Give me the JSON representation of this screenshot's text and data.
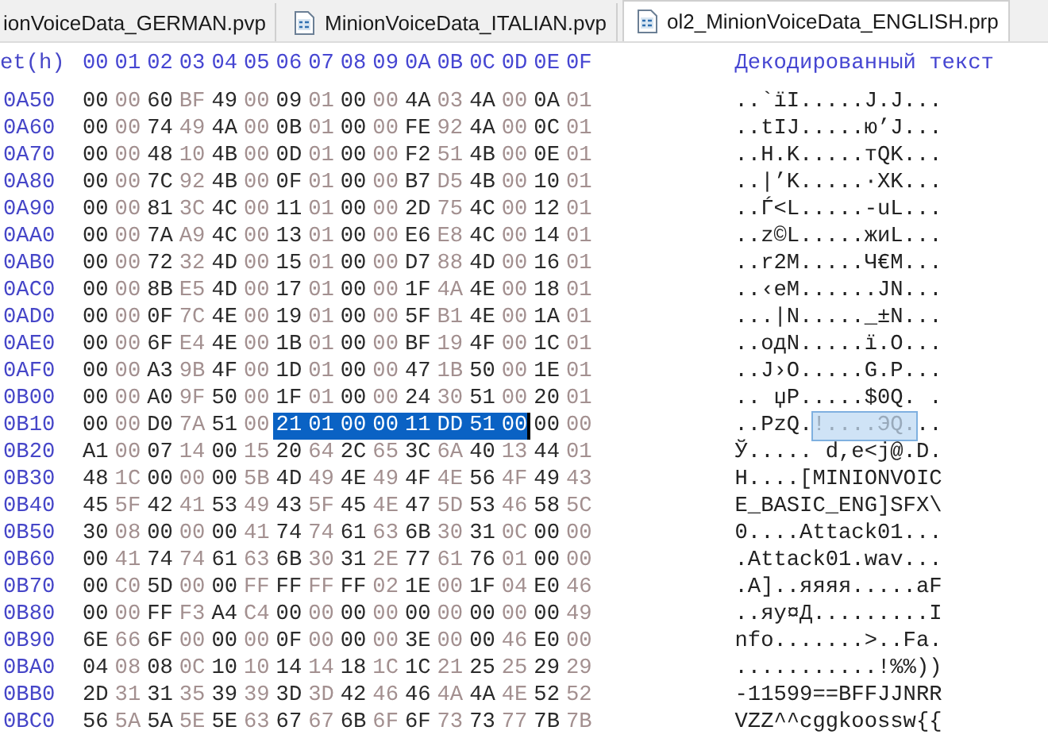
{
  "tabs": [
    {
      "label": "ionVoiceData_GERMAN.pvp",
      "selected": false,
      "icon": false
    },
    {
      "label": "MinionVoiceData_ITALIAN.pvp",
      "selected": false,
      "icon": true
    },
    {
      "label": "ol2_MinionVoiceData_ENGLISH.prp",
      "selected": true,
      "icon": true
    }
  ],
  "header": {
    "offset_label": "et(h)",
    "columns": [
      "00",
      "01",
      "02",
      "03",
      "04",
      "05",
      "06",
      "07",
      "08",
      "09",
      "0A",
      "0B",
      "0C",
      "0D",
      "0E",
      "0F"
    ],
    "text_label": "Декодированный текст"
  },
  "rows": [
    {
      "offset": "0A50",
      "bytes": [
        "00",
        "00",
        "60",
        "BF",
        "49",
        "00",
        "09",
        "01",
        "00",
        "00",
        "4A",
        "03",
        "4A",
        "00",
        "0A",
        "01"
      ],
      "text": "..`їI.....J.J..."
    },
    {
      "offset": "0A60",
      "bytes": [
        "00",
        "00",
        "74",
        "49",
        "4A",
        "00",
        "0B",
        "01",
        "00",
        "00",
        "FE",
        "92",
        "4A",
        "00",
        "0C",
        "01"
      ],
      "text": "..tIJ.....ю’J..."
    },
    {
      "offset": "0A70",
      "bytes": [
        "00",
        "00",
        "48",
        "10",
        "4B",
        "00",
        "0D",
        "01",
        "00",
        "00",
        "F2",
        "51",
        "4B",
        "00",
        "0E",
        "01"
      ],
      "text": "..H.K.....тQK..."
    },
    {
      "offset": "0A80",
      "bytes": [
        "00",
        "00",
        "7C",
        "92",
        "4B",
        "00",
        "0F",
        "01",
        "00",
        "00",
        "B7",
        "D5",
        "4B",
        "00",
        "10",
        "01"
      ],
      "text": "..|’K.....·ХK..."
    },
    {
      "offset": "0A90",
      "bytes": [
        "00",
        "00",
        "81",
        "3C",
        "4C",
        "00",
        "11",
        "01",
        "00",
        "00",
        "2D",
        "75",
        "4C",
        "00",
        "12",
        "01"
      ],
      "text": "..Ѓ<L.....-uL..."
    },
    {
      "offset": "0AA0",
      "bytes": [
        "00",
        "00",
        "7A",
        "A9",
        "4C",
        "00",
        "13",
        "01",
        "00",
        "00",
        "E6",
        "E8",
        "4C",
        "00",
        "14",
        "01"
      ],
      "text": "..z©L.....жиL..."
    },
    {
      "offset": "0AB0",
      "bytes": [
        "00",
        "00",
        "72",
        "32",
        "4D",
        "00",
        "15",
        "01",
        "00",
        "00",
        "D7",
        "88",
        "4D",
        "00",
        "16",
        "01"
      ],
      "text": "..r2M.....Ч€M..."
    },
    {
      "offset": "0AC0",
      "bytes": [
        "00",
        "00",
        "8B",
        "E5",
        "4D",
        "00",
        "17",
        "01",
        "00",
        "00",
        "1F",
        "4A",
        "4E",
        "00",
        "18",
        "01"
      ],
      "text": "..‹еM......JN..."
    },
    {
      "offset": "0AD0",
      "bytes": [
        "00",
        "00",
        "0F",
        "7C",
        "4E",
        "00",
        "19",
        "01",
        "00",
        "00",
        "5F",
        "B1",
        "4E",
        "00",
        "1A",
        "01"
      ],
      "text": "...|N....._±N..."
    },
    {
      "offset": "0AE0",
      "bytes": [
        "00",
        "00",
        "6F",
        "E4",
        "4E",
        "00",
        "1B",
        "01",
        "00",
        "00",
        "BF",
        "19",
        "4F",
        "00",
        "1C",
        "01"
      ],
      "text": "..oдN.....ї.O..."
    },
    {
      "offset": "0AF0",
      "bytes": [
        "00",
        "00",
        "A3",
        "9B",
        "4F",
        "00",
        "1D",
        "01",
        "00",
        "00",
        "47",
        "1B",
        "50",
        "00",
        "1E",
        "01"
      ],
      "text": "..Ј›O.....G.P..."
    },
    {
      "offset": "0B00",
      "bytes": [
        "00",
        "00",
        "A0",
        "9F",
        "50",
        "00",
        "1F",
        "01",
        "00",
        "00",
        "24",
        "30",
        "51",
        "00",
        "20",
        "01"
      ],
      "text": ".. џP.....$0Q. ."
    },
    {
      "offset": "0B10",
      "bytes": [
        "00",
        "00",
        "D0",
        "7A",
        "51",
        "00",
        "21",
        "01",
        "00",
        "00",
        "11",
        "DD",
        "51",
        "00",
        "00",
        "00"
      ],
      "selected_bytes": [
        false,
        false,
        false,
        false,
        false,
        false,
        true,
        true,
        true,
        true,
        true,
        true,
        true,
        true,
        false,
        false
      ],
      "text": [
        {
          "s": "..РzQ.",
          "selected": false
        },
        {
          "s": "!....ЭQ.",
          "selected": true
        },
        {
          "s": "..",
          "selected": false
        }
      ]
    },
    {
      "offset": "0B20",
      "bytes": [
        "A1",
        "00",
        "07",
        "14",
        "00",
        "15",
        "20",
        "64",
        "2C",
        "65",
        "3C",
        "6A",
        "40",
        "13",
        "44",
        "01"
      ],
      "text": "Ў..... d,e<j@.D."
    },
    {
      "offset": "0B30",
      "bytes": [
        "48",
        "1C",
        "00",
        "00",
        "00",
        "5B",
        "4D",
        "49",
        "4E",
        "49",
        "4F",
        "4E",
        "56",
        "4F",
        "49",
        "43"
      ],
      "text": "H....[MINIONVOIC"
    },
    {
      "offset": "0B40",
      "bytes": [
        "45",
        "5F",
        "42",
        "41",
        "53",
        "49",
        "43",
        "5F",
        "45",
        "4E",
        "47",
        "5D",
        "53",
        "46",
        "58",
        "5C"
      ],
      "text": "E_BASIC_ENG]SFX\\"
    },
    {
      "offset": "0B50",
      "bytes": [
        "30",
        "08",
        "00",
        "00",
        "00",
        "41",
        "74",
        "74",
        "61",
        "63",
        "6B",
        "30",
        "31",
        "0C",
        "00",
        "00"
      ],
      "text": "0....Attack01..."
    },
    {
      "offset": "0B60",
      "bytes": [
        "00",
        "41",
        "74",
        "74",
        "61",
        "63",
        "6B",
        "30",
        "31",
        "2E",
        "77",
        "61",
        "76",
        "01",
        "00",
        "00"
      ],
      "text": ".Attack01.wav..."
    },
    {
      "offset": "0B70",
      "bytes": [
        "00",
        "C0",
        "5D",
        "00",
        "00",
        "FF",
        "FF",
        "FF",
        "FF",
        "02",
        "1E",
        "00",
        "1F",
        "04",
        "E0",
        "46"
      ],
      "text": ".А]..яяяя.....аF"
    },
    {
      "offset": "0B80",
      "bytes": [
        "00",
        "00",
        "FF",
        "F3",
        "A4",
        "C4",
        "00",
        "00",
        "00",
        "00",
        "00",
        "00",
        "00",
        "00",
        "00",
        "49"
      ],
      "text": "..яу¤Д.........I"
    },
    {
      "offset": "0B90",
      "bytes": [
        "6E",
        "66",
        "6F",
        "00",
        "00",
        "00",
        "0F",
        "00",
        "00",
        "00",
        "3E",
        "00",
        "00",
        "46",
        "E0",
        "00"
      ],
      "text": "nfo.......>..Fа."
    },
    {
      "offset": "0BA0",
      "bytes": [
        "04",
        "08",
        "08",
        "0C",
        "10",
        "10",
        "14",
        "14",
        "18",
        "1C",
        "1C",
        "21",
        "25",
        "25",
        "29",
        "29"
      ],
      "text": "...........!%%))"
    },
    {
      "offset": "0BB0",
      "bytes": [
        "2D",
        "31",
        "31",
        "35",
        "39",
        "39",
        "3D",
        "3D",
        "42",
        "46",
        "46",
        "4A",
        "4A",
        "4E",
        "52",
        "52"
      ],
      "text": "-11599==BFFJJNRR"
    },
    {
      "offset": "0BC0",
      "bytes": [
        "56",
        "5A",
        "5A",
        "5E",
        "5E",
        "63",
        "67",
        "67",
        "6B",
        "6F",
        "6F",
        "73",
        "73",
        "77",
        "7B",
        "7B"
      ],
      "text": "VZZ^^cggkoossw{{"
    }
  ]
}
